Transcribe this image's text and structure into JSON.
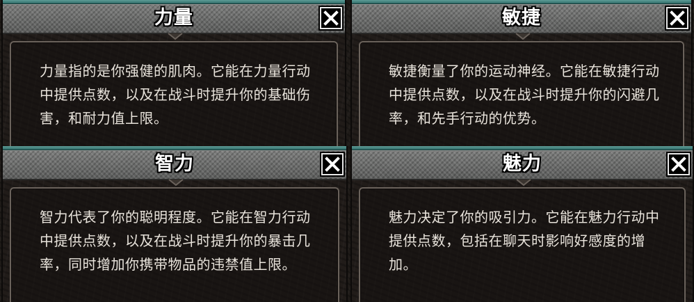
{
  "panels": [
    {
      "title": "力量",
      "description": "力量指的是你强健的肌肉。它能在力量行动中提供点数，以及在战斗时提升你的基础伤害，和耐力值上限。",
      "close_icon": "close-x-icon"
    },
    {
      "title": "敏捷",
      "description": "敏捷衡量了你的运动神经。它能在敏捷行动中提供点数，以及在战斗时提升你的闪避几率，和先手行动的优势。",
      "close_icon": "close-x-icon"
    },
    {
      "title": "智力",
      "description": "智力代表了你的聪明程度。它能在智力行动中提供点数，以及在战斗时提升你的暴击几率，同时增加你携带物品的违禁值上限。",
      "close_icon": "close-x-icon"
    },
    {
      "title": "魅力",
      "description": "魅力决定了你的吸引力。它能在魅力行动中提供点数，包括在聊天时影响好感度的增加。",
      "close_icon": "close-x-icon"
    }
  ],
  "colors": {
    "accent_teal": "#3f8a85",
    "title_bar": "#6b6c6b",
    "panel_bg": "#211c19",
    "text": "#e9e4dc"
  }
}
